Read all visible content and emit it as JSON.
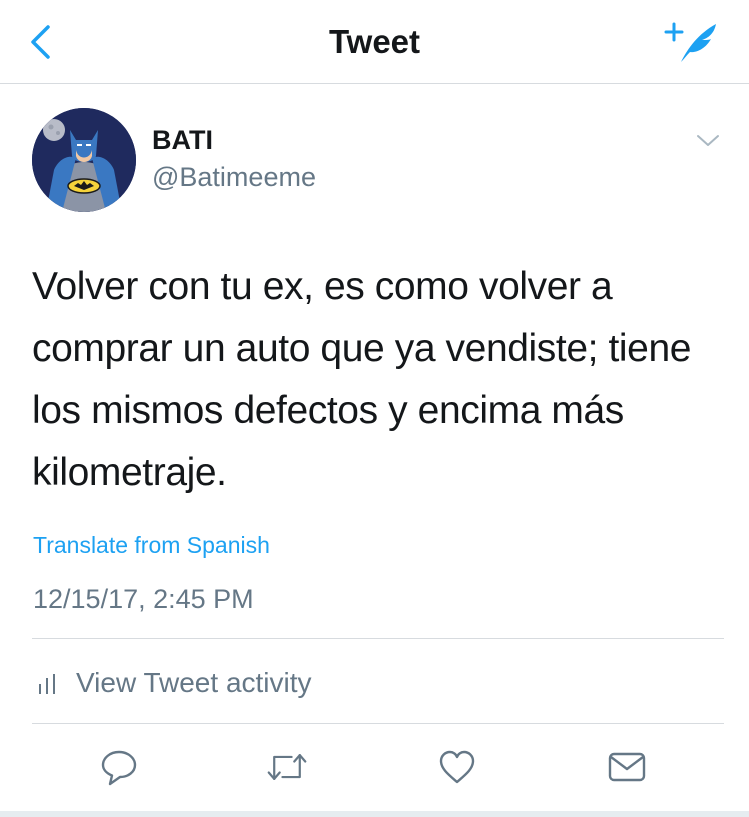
{
  "nav": {
    "title": "Tweet",
    "back_icon": "chevron-left-icon",
    "compose_icon": "compose-tweet-icon",
    "accent_color": "#1da1f2"
  },
  "user": {
    "name": "BATI",
    "handle": "@Batimeeme",
    "avatar": "batman-avatar"
  },
  "tweet": {
    "text": "Volver con tu ex, es como volver a comprar un auto que ya vendiste; tiene los mismos defectos y encima más kilometraje.",
    "translate_label": "Translate from Spanish",
    "timestamp": "12/15/17, 2:45 PM"
  },
  "activity": {
    "label": "View Tweet activity",
    "icon": "bar-chart-icon"
  },
  "actions": [
    {
      "name": "reply",
      "icon": "reply-icon"
    },
    {
      "name": "retweet",
      "icon": "retweet-icon"
    },
    {
      "name": "like",
      "icon": "heart-icon"
    },
    {
      "name": "direct-message",
      "icon": "envelope-icon"
    }
  ]
}
